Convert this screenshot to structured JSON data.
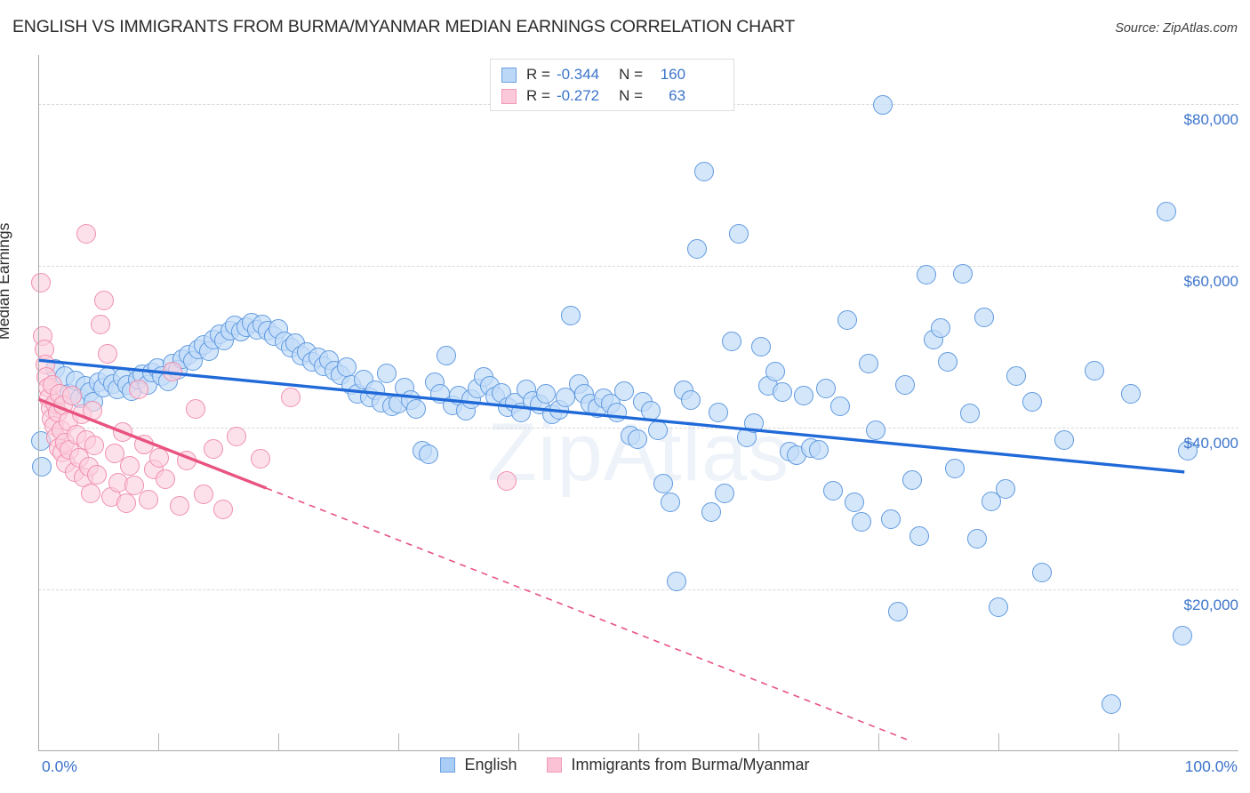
{
  "header": {
    "title": "ENGLISH VS IMMIGRANTS FROM BURMA/MYANMAR MEDIAN EARNINGS CORRELATION CHART",
    "source": "Source: ZipAtlas.com"
  },
  "watermark": "ZipAtlas",
  "stats": {
    "rows": [
      {
        "series": "English",
        "r_label": "R =",
        "r_value": "-0.344",
        "n_label": "N =",
        "n_value": "160",
        "color": "#bcd8f7"
      },
      {
        "series": "Immigrants from Burma/Myanmar",
        "r_label": "R =",
        "r_value": "-0.272",
        "n_label": "N =",
        "n_value": "63",
        "color": "#fbc9da"
      }
    ]
  },
  "axes": {
    "y_title": "Median Earnings",
    "y_ticks": [
      "$80,000",
      "$60,000",
      "$40,000",
      "$20,000"
    ],
    "x_min_label": "0.0%",
    "x_max_label": "100.0%"
  },
  "legend": {
    "entries": [
      {
        "label": "English",
        "color": "#a9cdf5"
      },
      {
        "label": "Immigrants from Burma/Myanmar",
        "color": "#fbc2d6"
      }
    ]
  },
  "chart_data": {
    "type": "scatter",
    "title": "ENGLISH VS IMMIGRANTS FROM BURMA/MYANMAR MEDIAN EARNINGS CORRELATION CHART",
    "xlabel": "",
    "ylabel": "Median Earnings",
    "xlim": [
      0,
      100
    ],
    "ylim": [
      0,
      86000
    ],
    "x_unit": "percent",
    "y_unit": "USD",
    "grid": true,
    "y_gridlines": [
      20000,
      40000,
      60000,
      80000
    ],
    "legend_position": "bottom-center",
    "series": [
      {
        "name": "English",
        "color": "#a9cdf5",
        "edge_color": "#5f9ae0",
        "R": -0.344,
        "N": 160,
        "trend": {
          "style": "solid",
          "color": "#1f69d8",
          "x0": 0,
          "y0": 48300,
          "x1": 95.5,
          "y1": 34500
        },
        "points": [
          [
            0.2,
            38300
          ],
          [
            0.3,
            35200
          ],
          [
            1.4,
            47200
          ],
          [
            2.2,
            46300
          ],
          [
            2.6,
            44100
          ],
          [
            3.1,
            45800
          ],
          [
            3.5,
            43600
          ],
          [
            3.9,
            45100
          ],
          [
            4.3,
            44400
          ],
          [
            4.6,
            43200
          ],
          [
            5.0,
            45600
          ],
          [
            5.4,
            44900
          ],
          [
            5.8,
            46200
          ],
          [
            6.2,
            45400
          ],
          [
            6.6,
            44700
          ],
          [
            7.0,
            46100
          ],
          [
            7.4,
            45300
          ],
          [
            7.8,
            44500
          ],
          [
            8.3,
            45900
          ],
          [
            8.7,
            46600
          ],
          [
            9.1,
            45200
          ],
          [
            9.5,
            46800
          ],
          [
            9.9,
            47300
          ],
          [
            10.3,
            46400
          ],
          [
            10.8,
            45700
          ],
          [
            11.2,
            47900
          ],
          [
            11.6,
            47100
          ],
          [
            12.0,
            48400
          ],
          [
            12.5,
            49000
          ],
          [
            12.9,
            48200
          ],
          [
            13.3,
            49600
          ],
          [
            13.8,
            50200
          ],
          [
            14.2,
            49400
          ],
          [
            14.6,
            50900
          ],
          [
            15.1,
            51500
          ],
          [
            15.5,
            50700
          ],
          [
            16.0,
            52000
          ],
          [
            16.4,
            52600
          ],
          [
            16.9,
            51800
          ],
          [
            17.3,
            52400
          ],
          [
            17.8,
            52900
          ],
          [
            18.2,
            52100
          ],
          [
            18.7,
            52700
          ],
          [
            19.1,
            51900
          ],
          [
            19.6,
            51300
          ],
          [
            20.0,
            52200
          ],
          [
            20.5,
            50600
          ],
          [
            21.0,
            49900
          ],
          [
            21.4,
            50400
          ],
          [
            21.9,
            48900
          ],
          [
            22.4,
            49300
          ],
          [
            22.8,
            48100
          ],
          [
            23.3,
            48700
          ],
          [
            23.8,
            47600
          ],
          [
            24.2,
            48300
          ],
          [
            24.7,
            47000
          ],
          [
            25.2,
            46500
          ],
          [
            25.7,
            47400
          ],
          [
            26.1,
            45300
          ],
          [
            26.6,
            44200
          ],
          [
            27.1,
            45900
          ],
          [
            27.6,
            43700
          ],
          [
            28.1,
            44600
          ],
          [
            28.6,
            43100
          ],
          [
            29.0,
            46700
          ],
          [
            29.5,
            42600
          ],
          [
            30.0,
            42900
          ],
          [
            30.5,
            44900
          ],
          [
            31.0,
            43400
          ],
          [
            31.5,
            42300
          ],
          [
            32.0,
            37100
          ],
          [
            32.5,
            36700
          ],
          [
            33.0,
            45600
          ],
          [
            33.5,
            44100
          ],
          [
            34.0,
            48900
          ],
          [
            34.5,
            42700
          ],
          [
            35.0,
            43900
          ],
          [
            35.6,
            42100
          ],
          [
            36.1,
            43500
          ],
          [
            36.6,
            44800
          ],
          [
            37.1,
            46200
          ],
          [
            37.6,
            45100
          ],
          [
            38.1,
            43800
          ],
          [
            38.6,
            44300
          ],
          [
            39.1,
            42500
          ],
          [
            39.7,
            43100
          ],
          [
            40.2,
            41900
          ],
          [
            40.7,
            44700
          ],
          [
            41.2,
            43300
          ],
          [
            41.8,
            42800
          ],
          [
            42.3,
            44100
          ],
          [
            42.8,
            41600
          ],
          [
            43.4,
            42200
          ],
          [
            43.9,
            43700
          ],
          [
            44.4,
            53800
          ],
          [
            45.0,
            45400
          ],
          [
            45.5,
            44200
          ],
          [
            46.0,
            43000
          ],
          [
            46.6,
            42400
          ],
          [
            47.1,
            43600
          ],
          [
            47.7,
            42900
          ],
          [
            48.2,
            41800
          ],
          [
            48.8,
            44500
          ],
          [
            49.3,
            39000
          ],
          [
            49.9,
            38500
          ],
          [
            50.4,
            43200
          ],
          [
            51.0,
            42100
          ],
          [
            51.6,
            39600
          ],
          [
            52.1,
            33100
          ],
          [
            52.7,
            30800
          ],
          [
            53.2,
            21000
          ],
          [
            53.8,
            44600
          ],
          [
            54.4,
            43400
          ],
          [
            54.9,
            62100
          ],
          [
            55.5,
            71600
          ],
          [
            56.1,
            29600
          ],
          [
            56.7,
            41900
          ],
          [
            57.2,
            31800
          ],
          [
            57.8,
            50600
          ],
          [
            58.4,
            63900
          ],
          [
            59.0,
            38800
          ],
          [
            59.6,
            40500
          ],
          [
            60.2,
            50000
          ],
          [
            60.8,
            45100
          ],
          [
            61.4,
            46900
          ],
          [
            62.0,
            44400
          ],
          [
            62.6,
            37000
          ],
          [
            63.2,
            36600
          ],
          [
            63.8,
            43900
          ],
          [
            64.4,
            37400
          ],
          [
            65.0,
            37200
          ],
          [
            65.6,
            44800
          ],
          [
            66.2,
            32200
          ],
          [
            66.8,
            42600
          ],
          [
            67.4,
            53300
          ],
          [
            68.0,
            30700
          ],
          [
            68.6,
            28300
          ],
          [
            69.2,
            47900
          ],
          [
            69.8,
            39700
          ],
          [
            70.4,
            79900
          ],
          [
            71.0,
            28700
          ],
          [
            71.6,
            17200
          ],
          [
            72.2,
            45200
          ],
          [
            72.8,
            33500
          ],
          [
            73.4,
            26600
          ],
          [
            74.0,
            58900
          ],
          [
            74.6,
            50800
          ],
          [
            75.2,
            52300
          ],
          [
            75.8,
            48100
          ],
          [
            76.4,
            34900
          ],
          [
            77.0,
            59000
          ],
          [
            77.6,
            41700
          ],
          [
            78.2,
            26300
          ],
          [
            78.8,
            53600
          ],
          [
            79.4,
            30900
          ],
          [
            80.0,
            17800
          ],
          [
            80.6,
            32400
          ],
          [
            81.5,
            46300
          ],
          [
            82.8,
            43200
          ],
          [
            83.6,
            22100
          ],
          [
            85.5,
            38400
          ],
          [
            88.0,
            47000
          ],
          [
            89.4,
            5800
          ],
          [
            91.0,
            44200
          ],
          [
            94.0,
            66700
          ],
          [
            95.3,
            14300
          ],
          [
            95.8,
            37100
          ]
        ]
      },
      {
        "name": "Immigrants from Burma/Myanmar",
        "color": "#fbc2d6",
        "edge_color": "#ef8fae",
        "R": -0.272,
        "N": 63,
        "trend": {
          "style": "solid-then-dashed",
          "color": "#e8537f",
          "x0": 0,
          "y0": 43500,
          "x1_solid": 19.0,
          "y1_solid": 32500,
          "x1_dashed": 72.8,
          "y1_dashed": 1200
        },
        "points": [
          [
            0.2,
            57900
          ],
          [
            0.4,
            51300
          ],
          [
            0.5,
            49600
          ],
          [
            0.6,
            47800
          ],
          [
            0.7,
            46200
          ],
          [
            0.8,
            44900
          ],
          [
            0.9,
            43600
          ],
          [
            1.0,
            42400
          ],
          [
            1.1,
            41100
          ],
          [
            1.2,
            45300
          ],
          [
            1.3,
            40200
          ],
          [
            1.4,
            43000
          ],
          [
            1.5,
            38800
          ],
          [
            1.6,
            41900
          ],
          [
            1.7,
            37500
          ],
          [
            1.8,
            44200
          ],
          [
            1.9,
            39600
          ],
          [
            2.0,
            36900
          ],
          [
            2.1,
            42700
          ],
          [
            2.2,
            38100
          ],
          [
            2.3,
            35600
          ],
          [
            2.5,
            40800
          ],
          [
            2.6,
            37200
          ],
          [
            2.8,
            43900
          ],
          [
            3.0,
            34500
          ],
          [
            3.2,
            39100
          ],
          [
            3.4,
            36300
          ],
          [
            3.6,
            41600
          ],
          [
            3.8,
            33800
          ],
          [
            4.0,
            38400
          ],
          [
            4.2,
            35100
          ],
          [
            4.4,
            31900
          ],
          [
            4.5,
            42100
          ],
          [
            4.7,
            37800
          ],
          [
            4.9,
            34200
          ],
          [
            4.0,
            63900
          ],
          [
            5.2,
            52700
          ],
          [
            5.5,
            55700
          ],
          [
            5.8,
            49100
          ],
          [
            6.1,
            31400
          ],
          [
            6.4,
            36800
          ],
          [
            6.7,
            33200
          ],
          [
            7.0,
            39400
          ],
          [
            7.3,
            30600
          ],
          [
            7.6,
            35300
          ],
          [
            8.0,
            32800
          ],
          [
            8.4,
            44700
          ],
          [
            8.8,
            37900
          ],
          [
            9.2,
            31100
          ],
          [
            9.6,
            34800
          ],
          [
            10.1,
            36200
          ],
          [
            10.6,
            33600
          ],
          [
            11.2,
            46900
          ],
          [
            11.8,
            30300
          ],
          [
            12.4,
            35900
          ],
          [
            13.1,
            42300
          ],
          [
            13.8,
            31700
          ],
          [
            14.6,
            37300
          ],
          [
            15.4,
            29900
          ],
          [
            16.5,
            38900
          ],
          [
            18.5,
            36100
          ],
          [
            21.0,
            43700
          ],
          [
            39.0,
            33400
          ]
        ]
      }
    ]
  }
}
